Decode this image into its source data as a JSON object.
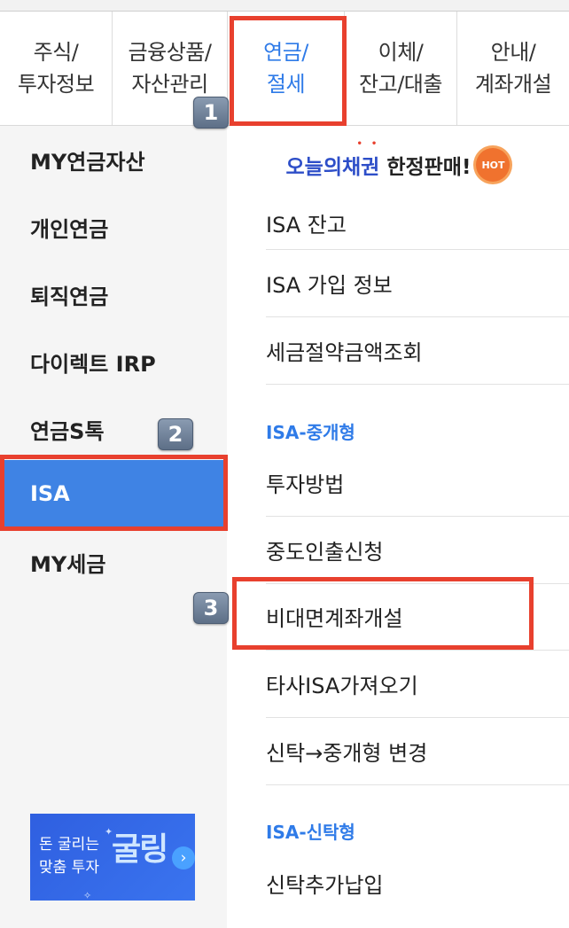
{
  "top_tabs": [
    {
      "line1": "주식/",
      "line2": "투자정보"
    },
    {
      "line1": "금융상품/",
      "line2": "자산관리"
    },
    {
      "line1": "연금/",
      "line2": "절세"
    },
    {
      "line1": "이체/",
      "line2": "잔고/대출"
    },
    {
      "line1": "안내/",
      "line2": "계좌개설"
    }
  ],
  "active_tab": "연금/절세",
  "left_menu": [
    {
      "label": "MY연금자산"
    },
    {
      "label": "개인연금"
    },
    {
      "label": "퇴직연금"
    },
    {
      "label": "다이렉트 IRP"
    },
    {
      "label": "연금S톡"
    },
    {
      "label": "ISA",
      "selected": true
    },
    {
      "label": "MY세금"
    }
  ],
  "promo": {
    "highlight": "오늘의채권",
    "text": "한정판매!",
    "hot": "HOT"
  },
  "right_menu": [
    {
      "label": "ISA 잔고"
    },
    {
      "label": "ISA 가입 정보"
    },
    {
      "label": "세금절약금액조회"
    }
  ],
  "section_broker": {
    "title": "ISA-중개형",
    "items": [
      {
        "label": "투자방법"
      },
      {
        "label": "중도인출신청"
      },
      {
        "label": "비대면계좌개설"
      },
      {
        "label": "타사ISA가져오기"
      },
      {
        "label": "신탁→중개형 변경"
      }
    ]
  },
  "section_trust": {
    "title": "ISA-신탁형",
    "items": [
      {
        "label": "신탁추가납입"
      }
    ]
  },
  "banner": {
    "line1": "돈 굴리는",
    "line2": "맞춤 투자",
    "brand": "굴링",
    "arrow": "›"
  },
  "step_badges": [
    "1",
    "2",
    "3"
  ],
  "colors": {
    "accent": "#2f7be8",
    "selected_bg": "#3f83e4",
    "highlight_box": "#e8402e"
  }
}
